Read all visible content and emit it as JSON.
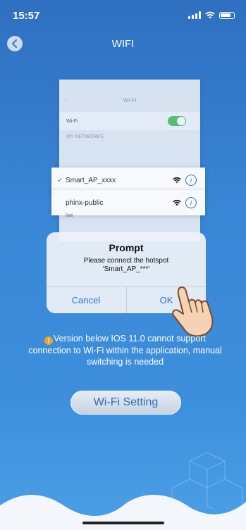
{
  "status_bar": {
    "time": "15:57"
  },
  "header": {
    "title": "WIFI"
  },
  "illustration": {
    "wifi_row_label": "Wi-Fi",
    "section_label": "MY NETWORKS",
    "nav_title": "Wi-Fi",
    "networks": [
      {
        "name": "Smart_AP_xxxx",
        "selected": true
      },
      {
        "name": "phinx-public",
        "selected": false
      }
    ],
    "live_label": "live"
  },
  "dialog": {
    "title": "Prompt",
    "message_line1": "Please connect the hotspot",
    "message_line2": "'Smart_AP_***'",
    "cancel_label": "Cancel",
    "ok_label": "OK"
  },
  "notice": {
    "text": "Version below IOS 11.0 cannot support connection to Wi-Fi within the application, manual switching is needed"
  },
  "actions": {
    "wifi_setting_label": "Wi-Fi Setting"
  },
  "colors": {
    "accent": "#2f73c7",
    "background": "#3a86d6",
    "warning": "#f0a030"
  }
}
